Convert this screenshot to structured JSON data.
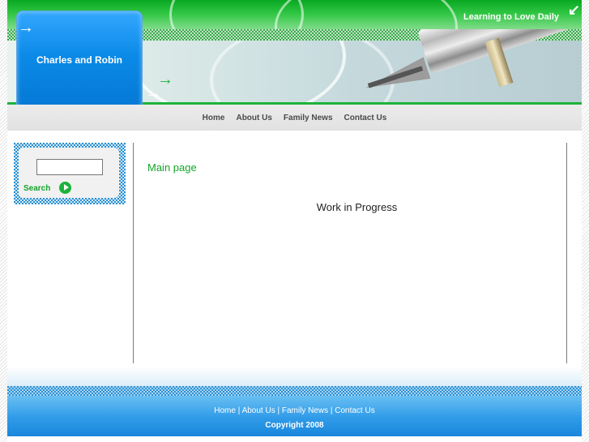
{
  "header": {
    "tagline": "Learning to Love Daily",
    "brand_name": "Charles and Robin",
    "icons": [
      "corner-arrow-icon",
      "arrow-right-icon"
    ]
  },
  "nav": {
    "items": [
      {
        "label": "Home"
      },
      {
        "label": "About Us"
      },
      {
        "label": "Family News"
      },
      {
        "label": "Contact Us"
      }
    ]
  },
  "sidebar": {
    "search": {
      "value": "",
      "placeholder": "",
      "label": "Search"
    }
  },
  "main": {
    "heading": "Main page",
    "body_text": "Work in Progress"
  },
  "footer": {
    "links": [
      {
        "label": "Home"
      },
      {
        "label": "About Us"
      },
      {
        "label": "Family News"
      },
      {
        "label": "Contact Us"
      }
    ],
    "separator": " | ",
    "copyright": "Copyright 2008"
  },
  "colors": {
    "accent_green": "#1db33a",
    "brand_blue": "#0b8ae8",
    "footer_blue": "#2f9be8"
  }
}
